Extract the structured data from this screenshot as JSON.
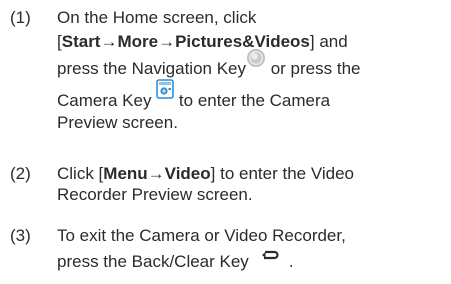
{
  "steps": [
    {
      "number": "(1)",
      "lines": {
        "l1": "On the Home screen, click",
        "l2_open": "[",
        "l2_start": "Start",
        "l2_arrow1": "→",
        "l2_more": "More",
        "l2_arrow2": "→",
        "l2_pics": "Pictures&Videos",
        "l2_close": "] and",
        "l3_a": "press the Navigation Key",
        "l3_b": " or press the",
        "l4_a": "Camera Key ",
        "l4_b": " to enter the Camera",
        "l5": "Preview screen."
      },
      "icons": [
        "navigation-key-icon",
        "camera-key-icon"
      ]
    },
    {
      "number": "(2)",
      "lines": {
        "l1_a": "Click [",
        "l1_menu": "Menu",
        "l1_arrow": "→",
        "l1_video": "Video",
        "l1_b": "] to enter the Video",
        "l2": "Recorder Preview screen."
      }
    },
    {
      "number": "(3)",
      "lines": {
        "l1": "To exit the Camera or Video Recorder,",
        "l2_a": "press the Back/Clear Key",
        "l2_b": "."
      },
      "icons": [
        "back-clear-key-icon"
      ]
    }
  ],
  "colors": {
    "text": "#2b2b2b",
    "camera_icon_blue": "#2f8fd8",
    "nav_key_gray": "#9c9c9c"
  }
}
